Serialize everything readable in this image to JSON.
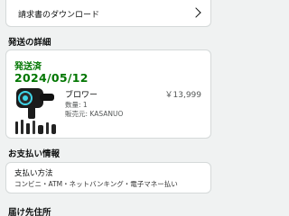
{
  "invoice": {
    "label": "請求書のダウンロード"
  },
  "shipping": {
    "section_title": "発送の詳細",
    "status": "発送済",
    "date": "2024/05/12",
    "item": {
      "name": "ブロワー",
      "quantity": "数量: 1",
      "seller": "販売元: KASANUO",
      "price": "￥13,999",
      "image_icon": "blower-product-image"
    }
  },
  "payment": {
    "section_title": "お支払い情報",
    "method_label": "支払い方法",
    "method_value": "コンビニ・ATM・ネットバンキング・電子マネー払い"
  },
  "delivery": {
    "section_title": "届け先住所"
  },
  "colors": {
    "status_green": "#007600",
    "background": "#f0f2f2",
    "border": "#d5d9d9"
  }
}
